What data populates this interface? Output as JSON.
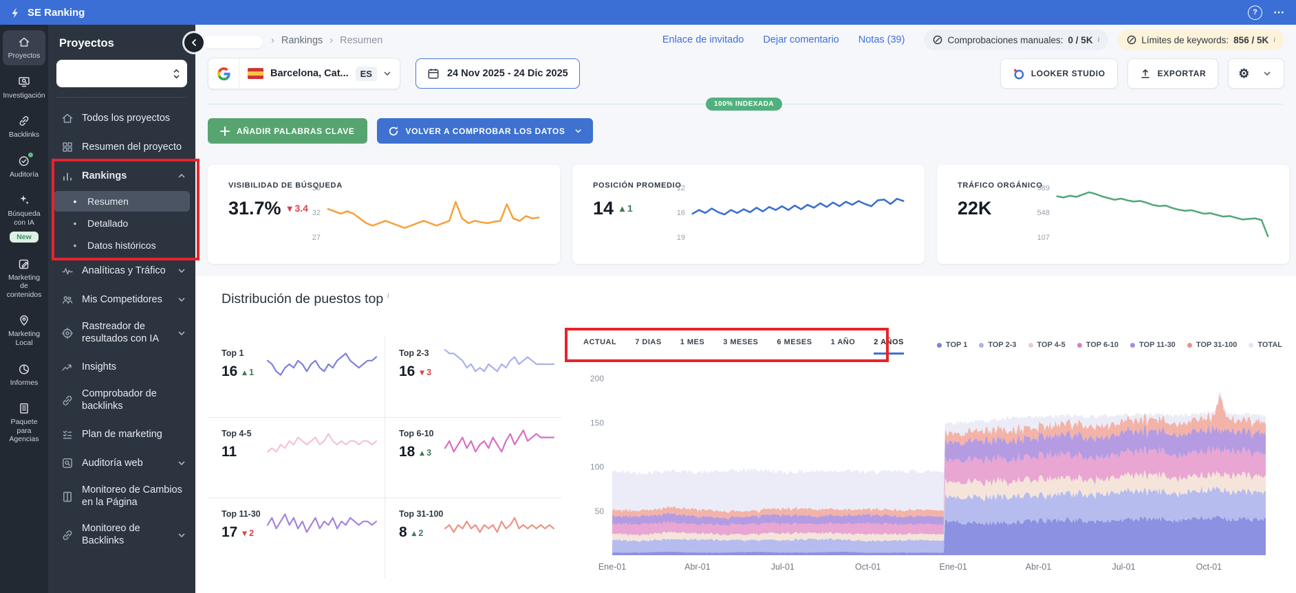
{
  "topbar": {
    "brand": "SE Ranking",
    "help": "?",
    "more": "⋯"
  },
  "rail": {
    "items": [
      {
        "label": "Proyectos",
        "icon": "home-icon",
        "active": true
      },
      {
        "label": "Investigación",
        "icon": "research-icon"
      },
      {
        "label": "Backlinks",
        "icon": "backlink-icon"
      },
      {
        "label": "Auditoría",
        "icon": "audit-icon",
        "status_dot": true
      },
      {
        "label": "Búsqueda con IA",
        "icon": "ai-sparkles-icon",
        "badge": "New"
      },
      {
        "label": "Marketing de contenidos",
        "icon": "content-marketing-icon"
      },
      {
        "label": "Marketing Local",
        "icon": "local-marketing-icon"
      },
      {
        "label": "Informes",
        "icon": "reports-icon"
      },
      {
        "label": "Paquete para Agencias",
        "icon": "agency-icon"
      }
    ]
  },
  "sidebar": {
    "title": "Proyectos",
    "project_select_value": "",
    "items": [
      {
        "label": "Todos los proyectos",
        "icon": "home-icon"
      },
      {
        "label": "Resumen del proyecto",
        "icon": "overview-grid-icon"
      },
      {
        "label": "Rankings",
        "icon": "rankings-bars-icon",
        "bold": true,
        "chevron": "up"
      },
      {
        "label": "Resumen",
        "sub": true,
        "active": true
      },
      {
        "label": "Detallado",
        "sub": true
      },
      {
        "label": "Datos históricos",
        "sub": true
      },
      {
        "label": "Analíticas y Tráfico",
        "icon": "analytics-pulse-icon",
        "chevron": "down"
      },
      {
        "label": "Mis Competidores",
        "icon": "competitors-icon",
        "chevron": "down"
      },
      {
        "label": "Rastreador de resultados con IA",
        "icon": "ai-tracker-icon",
        "chevron": "down",
        "two": true
      },
      {
        "label": "Insights",
        "icon": "insights-icon"
      },
      {
        "label": "Comprobador de backlinks",
        "icon": "backlink-checker-icon",
        "two": true
      },
      {
        "label": "Plan de marketing",
        "icon": "marketing-plan-icon"
      },
      {
        "label": "Auditoría web",
        "icon": "web-audit-icon",
        "chevron": "down"
      },
      {
        "label": "Monitoreo de Cambios en la Página",
        "icon": "page-changes-icon",
        "two": true
      },
      {
        "label": "Monitoreo de Backlinks",
        "icon": "backlink-monitor-icon",
        "chevron": "down",
        "two": true
      }
    ]
  },
  "breadcrumb": {
    "sep": "›",
    "items": [
      "Rankings",
      "Resumen"
    ]
  },
  "header_links": [
    {
      "label": "Enlace de invitado"
    },
    {
      "label": "Dejar comentario"
    },
    {
      "label": "Notas (39)"
    }
  ],
  "quota_pills": [
    {
      "label": "Comprobaciones manuales:",
      "value": "0 / 5K",
      "sup": "i",
      "tone": "gray"
    },
    {
      "label": "Límites de keywords:",
      "value": "856 / 5K",
      "sup": "i",
      "tone": "yellow"
    }
  ],
  "controls": {
    "location_label": "Barcelona, Cat...",
    "lang": "ES",
    "date_range": "24 Nov 2025 - 24 Dic 2025",
    "looker_label": "LOOKER STUDIO",
    "export_label": "EXPORTAR"
  },
  "indexed_badge": "100% INDEXADA",
  "action_buttons": {
    "add_keywords": "AÑADIR PALABRAS CLAVE",
    "recheck": "VOLVER A COMPROBAR LOS DATOS"
  },
  "metrics": [
    {
      "title": "VISIBILIDAD DE BÚSQUEDA",
      "value": "31.7%",
      "delta": "3.4",
      "delta_dir": "down",
      "axis": [
        "38",
        "32",
        "27"
      ],
      "spark": "visibility_spark"
    },
    {
      "title": "POSICIÓN PROMEDIO",
      "value": "14",
      "delta": "1",
      "delta_dir": "up",
      "axis": [
        "12",
        "16",
        "19"
      ],
      "spark": "position_spark"
    },
    {
      "title": "TRÁFICO ORGÁNICO",
      "value": "22K",
      "delta": "",
      "delta_dir": "",
      "axis": [
        "989",
        "548",
        "107"
      ],
      "spark": "traffic_spark"
    }
  ],
  "distribution": {
    "title": "Distribución de puestos top",
    "info_sup": "i",
    "tabs": [
      "ACTUAL",
      "7 DIAS",
      "1 MES",
      "3 MESES",
      "6 MESES",
      "1 AÑO",
      "2 AÑOS"
    ],
    "active_tab": "2 AÑOS",
    "legend": [
      {
        "label": "TOP 1",
        "color": "#7b80dc"
      },
      {
        "label": "TOP 2-3",
        "color": "#abb0ea"
      },
      {
        "label": "TOP 4-5",
        "color": "#f0c9d3"
      },
      {
        "label": "TOP 6-10",
        "color": "#da7ec6"
      },
      {
        "label": "TOP 11-30",
        "color": "#a88cdc"
      },
      {
        "label": "TOP 31-100",
        "color": "#ee8f85"
      },
      {
        "label": "TOTAL",
        "color": "#e4e5f4"
      }
    ],
    "minicards": [
      {
        "label": "Top 1",
        "value": "16",
        "delta": "1",
        "delta_dir": "up",
        "spark": "top1_spark"
      },
      {
        "label": "Top 2-3",
        "value": "16",
        "delta": "3",
        "delta_dir": "down",
        "spark": "top2_3_spark"
      },
      {
        "label": "Top 4-5",
        "value": "11",
        "delta": "",
        "delta_dir": "",
        "spark": "top4_5_spark"
      },
      {
        "label": "Top 6-10",
        "value": "18",
        "delta": "3",
        "delta_dir": "up",
        "spark": "top6_10_spark"
      },
      {
        "label": "Top 11-30",
        "value": "17",
        "delta": "2",
        "delta_dir": "down",
        "spark": "top11_30_spark"
      },
      {
        "label": "Top 31-100",
        "value": "8",
        "delta": "2",
        "delta_dir": "up",
        "spark": "top31_100_spark"
      }
    ]
  },
  "chart_data": [
    {
      "name": "distribution_area",
      "type": "area",
      "title": "Distribución de puestos top",
      "x_labels": [
        "Ene-01",
        "Abr-01",
        "Jul-01",
        "Oct-01",
        "Ene-01",
        "Abr-01",
        "Jul-01",
        "Oct-01"
      ],
      "x_label_months": [
        0,
        3,
        6,
        9,
        12,
        15,
        18,
        21
      ],
      "yticks": [
        50,
        100,
        150,
        200
      ],
      "ylim": [
        0,
        210
      ],
      "legend_position": "top-right",
      "series": [
        {
          "name": "TOP 1",
          "color": "#8d91e1",
          "values": [
            3,
            3,
            4,
            3,
            3,
            4,
            3,
            3,
            4,
            3,
            3,
            3,
            38,
            36,
            37,
            39,
            40,
            38,
            40,
            41,
            40,
            42,
            41,
            40
          ]
        },
        {
          "name": "TOP 2-3",
          "color": "#b7bcee",
          "values": [
            14,
            13,
            14,
            15,
            14,
            13,
            14,
            15,
            14,
            13,
            14,
            14,
            28,
            29,
            30,
            28,
            31,
            30,
            32,
            31,
            30,
            32,
            31,
            32
          ]
        },
        {
          "name": "TOP 4-5",
          "color": "#f4e4da",
          "values": [
            7,
            7,
            8,
            7,
            6,
            7,
            8,
            7,
            7,
            8,
            7,
            7,
            17,
            18,
            17,
            19,
            18,
            17,
            18,
            19,
            18,
            17,
            19,
            18
          ]
        },
        {
          "name": "TOP 6-10",
          "color": "#e9a6d2",
          "values": [
            11,
            12,
            11,
            10,
            11,
            12,
            11,
            10,
            11,
            12,
            11,
            11,
            25,
            26,
            24,
            26,
            27,
            25,
            26,
            27,
            26,
            28,
            27,
            26
          ]
        },
        {
          "name": "TOP 11-30",
          "color": "#b59ce2",
          "values": [
            9,
            9,
            10,
            9,
            8,
            9,
            10,
            9,
            9,
            10,
            9,
            9,
            20,
            21,
            22,
            21,
            23,
            22,
            23,
            22,
            24,
            23,
            22,
            23
          ]
        },
        {
          "name": "TOP 31-100",
          "color": "#f3b3a8",
          "values": [
            7,
            6,
            7,
            8,
            7,
            6,
            7,
            8,
            7,
            6,
            7,
            7,
            10,
            11,
            12,
            11,
            12,
            13,
            12,
            13,
            12,
            14,
            13,
            12
          ]
        }
      ],
      "total": {
        "name": "TOTAL",
        "color": "#ebecf7",
        "values": [
          95,
          93,
          96,
          94,
          95,
          97,
          94,
          95,
          96,
          94,
          95,
          95,
          150,
          152,
          155,
          156,
          158,
          157,
          159,
          160,
          158,
          162,
          160,
          159
        ]
      },
      "spike": {
        "month": 21.4,
        "height": 26
      }
    },
    {
      "name": "visibility_spark",
      "type": "line",
      "color": "#f6a13b",
      "ylim": [
        27,
        38
      ],
      "axis_labels": [
        "38",
        "32",
        "27"
      ],
      "values": [
        33.5,
        33,
        32.5,
        33,
        32.5,
        31.5,
        30.5,
        30,
        30.5,
        31,
        30.5,
        30,
        29.5,
        30,
        30.5,
        31,
        30.5,
        30,
        30.5,
        31,
        35,
        31.5,
        30.5,
        31,
        30.7,
        30.5,
        30.8,
        31,
        34.5,
        31.5,
        31,
        32,
        31.5,
        31.7
      ]
    },
    {
      "name": "position_spark",
      "type": "line",
      "color": "#3a6ed0",
      "ylim": [
        12,
        19
      ],
      "invert": true,
      "axis_labels": [
        "12",
        "16",
        "19"
      ],
      "values": [
        15.5,
        15,
        15.4,
        14.8,
        15.3,
        15.6,
        15,
        15.4,
        14.9,
        15.3,
        14.7,
        15.2,
        14.6,
        15,
        14.5,
        15,
        14.4,
        14.9,
        14.3,
        14.7,
        14.1,
        14.6,
        14,
        14.5,
        13.9,
        14.3,
        13.8,
        14.2,
        14.5,
        13.7,
        13.6,
        14.2,
        13.5,
        13.8
      ]
    },
    {
      "name": "traffic_spark",
      "type": "line",
      "color": "#55a878",
      "ylim": [
        100,
        1000
      ],
      "axis_labels": [
        "989",
        "548",
        "107"
      ],
      "values": [
        850,
        830,
        860,
        840,
        880,
        920,
        890,
        850,
        820,
        790,
        810,
        780,
        760,
        770,
        740,
        700,
        680,
        690,
        650,
        620,
        600,
        610,
        580,
        550,
        560,
        530,
        500,
        510,
        480,
        450,
        460,
        470,
        440,
        160
      ]
    },
    {
      "name": "top1_spark",
      "type": "line",
      "color": "#7c80dd",
      "ylim": [
        0,
        10
      ],
      "values": [
        6,
        5,
        3,
        2,
        4,
        5,
        4,
        6,
        5,
        3,
        5,
        6,
        4,
        3,
        5,
        4,
        6,
        7,
        8,
        6,
        5,
        4,
        5,
        6,
        6,
        7
      ]
    },
    {
      "name": "top2_3_spark",
      "type": "line",
      "color": "#aab0ea",
      "ylim": [
        0,
        10
      ],
      "values": [
        9,
        8,
        8,
        7,
        6,
        4,
        5,
        3,
        4,
        3,
        5,
        4,
        3,
        5,
        4,
        6,
        7,
        5,
        6,
        7,
        6,
        5,
        5,
        5,
        5,
        5
      ]
    },
    {
      "name": "top4_5_spark",
      "type": "line",
      "color": "#f3c3cf",
      "ylim": [
        0,
        10
      ],
      "values": [
        3,
        4,
        3,
        5,
        4,
        6,
        5,
        7,
        6,
        5,
        6,
        7,
        5,
        6,
        8,
        6,
        5,
        6,
        5,
        6,
        6,
        5,
        6,
        6,
        5,
        6
      ]
    },
    {
      "name": "top6_10_spark",
      "type": "line",
      "color": "#d86fc3",
      "ylim": [
        0,
        10
      ],
      "values": [
        4,
        6,
        3,
        5,
        7,
        4,
        6,
        3,
        5,
        6,
        4,
        7,
        5,
        3,
        6,
        8,
        5,
        7,
        9,
        6,
        7,
        8,
        7,
        7,
        7,
        7
      ]
    },
    {
      "name": "top11_30_spark",
      "type": "line",
      "color": "#a583dd",
      "ylim": [
        0,
        10
      ],
      "values": [
        5,
        7,
        4,
        6,
        8,
        5,
        7,
        4,
        6,
        3,
        5,
        7,
        4,
        6,
        5,
        7,
        4,
        6,
        5,
        7,
        6,
        5,
        6,
        6,
        5,
        6
      ]
    },
    {
      "name": "top31_100_spark",
      "type": "line",
      "color": "#ef9184",
      "ylim": [
        0,
        10
      ],
      "values": [
        4,
        5,
        3,
        5,
        4,
        6,
        4,
        5,
        3,
        5,
        4,
        5,
        3,
        6,
        4,
        5,
        7,
        4,
        5,
        4,
        5,
        4,
        5,
        4,
        5,
        4
      ]
    }
  ],
  "colors": {
    "accent_blue": "#3e6fd6",
    "green_button": "#57a470",
    "badge_green": "#52b07e",
    "delta_up": "#3f7a5a",
    "delta_down": "#d9434a",
    "annotation_red": "#e8232a"
  }
}
